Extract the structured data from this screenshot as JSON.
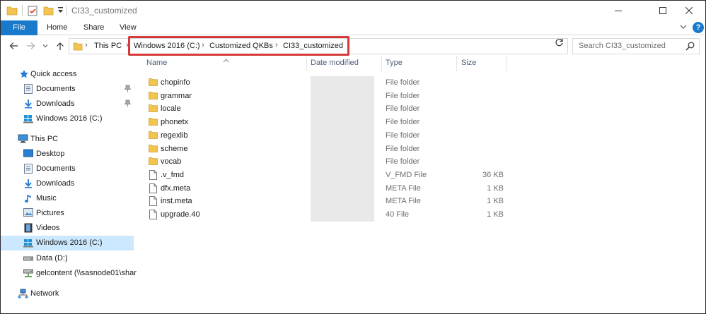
{
  "window": {
    "title": "CI33_customized"
  },
  "ribbon": {
    "tabs": [
      "File",
      "Home",
      "Share",
      "View"
    ],
    "help_label": "?"
  },
  "address": {
    "crumbs": [
      "This PC",
      "Windows 2016 (C:)",
      "Customized QKBs",
      "CI33_customized"
    ]
  },
  "search": {
    "placeholder": "Search CI33_customized"
  },
  "nav": {
    "quick_access": "Quick access",
    "qa_items": [
      "Documents",
      "Downloads",
      "Windows 2016 (C:)"
    ],
    "this_pc": "This PC",
    "pc_items": [
      "Desktop",
      "Documents",
      "Downloads",
      "Music",
      "Pictures",
      "Videos",
      "Windows 2016 (C:)",
      "Data (D:)",
      "gelcontent (\\\\sasnode01\\shar"
    ],
    "network": "Network",
    "selected": "Windows 2016 (C:)"
  },
  "columns": [
    "Name",
    "Date modified",
    "Type",
    "Size"
  ],
  "files": [
    {
      "name": "chopinfo",
      "type": "File folder",
      "size": "",
      "kind": "folder"
    },
    {
      "name": "grammar",
      "type": "File folder",
      "size": "",
      "kind": "folder"
    },
    {
      "name": "locale",
      "type": "File folder",
      "size": "",
      "kind": "folder"
    },
    {
      "name": "phonetx",
      "type": "File folder",
      "size": "",
      "kind": "folder"
    },
    {
      "name": "regexlib",
      "type": "File folder",
      "size": "",
      "kind": "folder"
    },
    {
      "name": "scheme",
      "type": "File folder",
      "size": "",
      "kind": "folder"
    },
    {
      "name": "vocab",
      "type": "File folder",
      "size": "",
      "kind": "folder"
    },
    {
      "name": ".v_fmd",
      "type": "V_FMD File",
      "size": "36 KB",
      "kind": "file"
    },
    {
      "name": "dfx.meta",
      "type": "META File",
      "size": "1 KB",
      "kind": "file"
    },
    {
      "name": "inst.meta",
      "type": "META File",
      "size": "1 KB",
      "kind": "file"
    },
    {
      "name": "upgrade.40",
      "type": "40 File",
      "size": "1 KB",
      "kind": "file"
    }
  ],
  "colors": {
    "accent": "#1979ca",
    "selection": "#cce8ff",
    "highlight_box": "#d43a3a",
    "folder": "#f3c550"
  }
}
